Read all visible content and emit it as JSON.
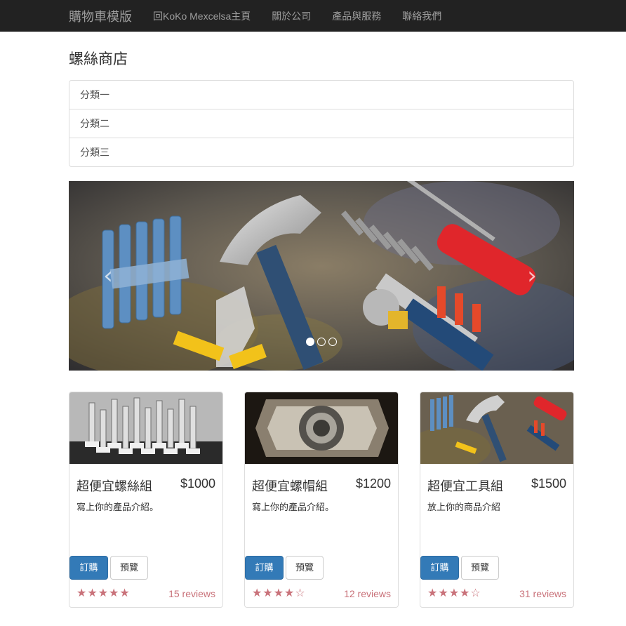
{
  "navbar": {
    "brand": "購物車模版",
    "links": [
      "回KoKo Mexcelsa主頁",
      "關於公司",
      "產品與服務",
      "聯絡我們"
    ]
  },
  "page_title": "螺絲商店",
  "categories": [
    "分類一",
    "分類二",
    "分類三"
  ],
  "carousel": {
    "prev_icon": "‹",
    "next_icon": "›",
    "slide_count": 3,
    "active_slide": 0
  },
  "products": [
    {
      "name": "超便宜螺絲組",
      "price": "$1000",
      "description": "寫上你的產品介紹。",
      "order_label": "訂購",
      "preview_label": "預覽",
      "stars": "★★★★★",
      "rating": 5,
      "reviews": "15 reviews"
    },
    {
      "name": "超便宜螺帽組",
      "price": "$1200",
      "description": "寫上你的產品介紹。",
      "order_label": "訂購",
      "preview_label": "預覽",
      "stars": "★★★★☆",
      "rating": 4,
      "reviews": "12 reviews"
    },
    {
      "name": "超便宜工具組",
      "price": "$1500",
      "description": "放上你的商品介紹",
      "order_label": "訂購",
      "preview_label": "預覽",
      "stars": "★★★★☆",
      "rating": 4,
      "reviews": "31 reviews"
    }
  ],
  "colors": {
    "navbar_bg": "#222222",
    "nav_text": "#9d9d9d",
    "primary": "#337ab7",
    "rating": "#c9727a"
  }
}
